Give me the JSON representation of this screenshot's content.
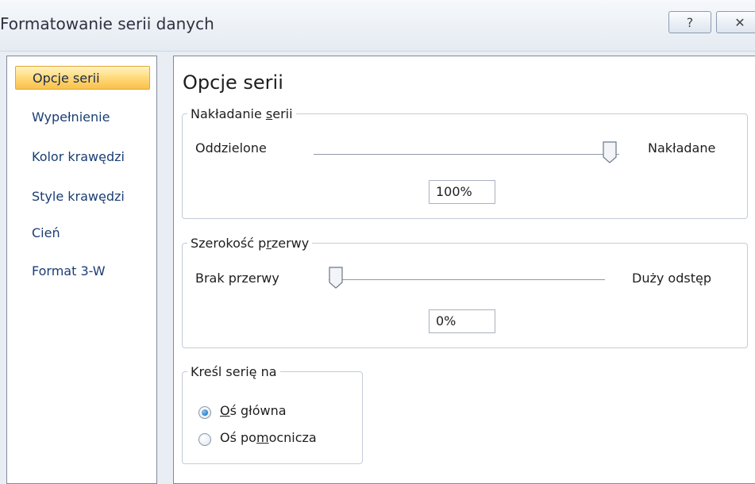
{
  "window": {
    "title": "Formatowanie serii danych",
    "help_icon": "help-icon",
    "close_icon": "close-icon",
    "help_glyph": "?",
    "close_glyph": "✕"
  },
  "nav": {
    "items": [
      {
        "label": "Opcje serii",
        "selected": true
      },
      {
        "label": "Wypełnienie",
        "selected": false
      },
      {
        "label": "Kolor krawędzi",
        "selected": false
      },
      {
        "label": "Style krawędzi",
        "selected": false
      },
      {
        "label": "Cień",
        "selected": false
      },
      {
        "label": "Format 3-W",
        "selected": false
      }
    ]
  },
  "main": {
    "title": "Opcje serii",
    "overlap": {
      "legend_pre": "Nakładanie ",
      "legend_key": "s",
      "legend_post": "erii",
      "left_label": "Oddzielone",
      "right_label": "Nakładane",
      "value_text": "100%",
      "value": 100
    },
    "gap": {
      "legend_pre": "Szerokość p",
      "legend_key": "r",
      "legend_post": "zerwy",
      "left_label": "Brak przerwy",
      "right_label": "Duży odstęp",
      "value_text": "0%",
      "value": 0
    },
    "plot_on": {
      "legend": "Kreśl serię na",
      "primary": {
        "pre": "",
        "key": "O",
        "post": "ś główna",
        "checked": true
      },
      "secondary": {
        "pre": "Oś po",
        "key": "m",
        "post": "ocnicza",
        "checked": false
      }
    }
  },
  "colors": {
    "selected_nav": "#ffd774",
    "nav_text": "#1a3e75",
    "radio_checked": "#2f7ec9"
  }
}
